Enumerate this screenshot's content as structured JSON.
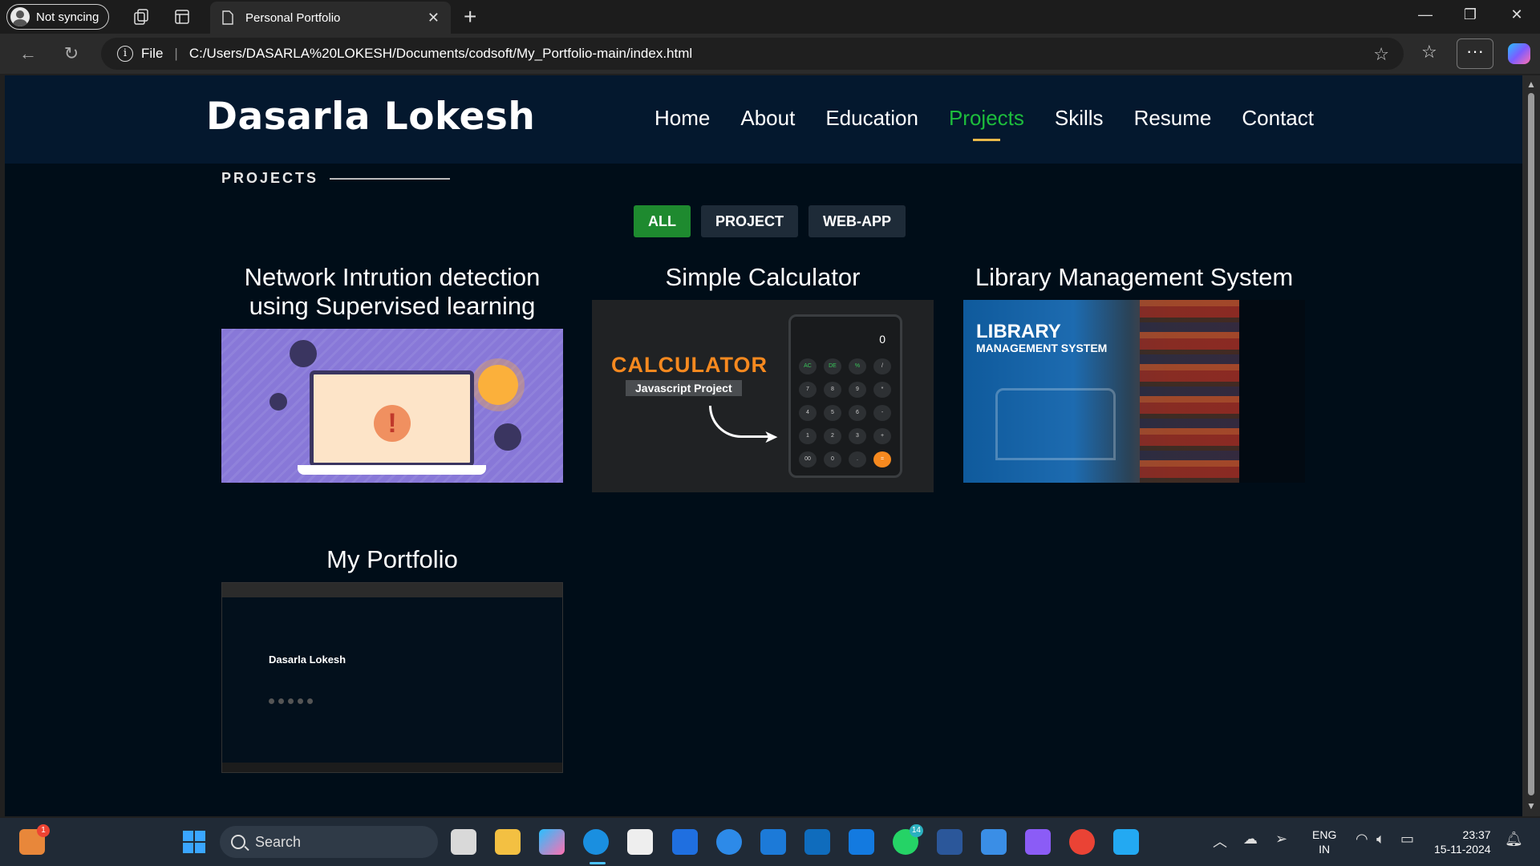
{
  "browser": {
    "profile_label": "Not syncing",
    "tab_title": "Personal Portfolio",
    "file_label": "File",
    "url": "C:/Users/DASARLA%20LOKESH/Documents/codsoft/My_Portfolio-main/index.html"
  },
  "site": {
    "brand": "Dasarla Lokesh",
    "nav": [
      "Home",
      "About",
      "Education",
      "Projects",
      "Skills",
      "Resume",
      "Contact"
    ],
    "active_nav": "Projects",
    "accent_color": "#1dbd3c",
    "underline_color": "#e8b84a"
  },
  "projects": {
    "section_title": "PROJECTS",
    "filters": [
      {
        "label": "ALL",
        "active": true
      },
      {
        "label": "PROJECT",
        "active": false
      },
      {
        "label": "WEB-APP",
        "active": false
      }
    ],
    "cards": [
      {
        "title": "Network Intrution detection using Supervised learning"
      },
      {
        "title": "Simple Calculator",
        "image_text": {
          "heading": "CALCULATOR",
          "sub": "Javascript Project",
          "display": "0"
        }
      },
      {
        "title": "Library Management System",
        "image_text": {
          "heading": "LIBRARY",
          "sub": "MANAGEMENT SYSTEM"
        }
      },
      {
        "title": "My Portfolio",
        "image_text": {
          "name": "Dasarla Lokesh"
        }
      }
    ]
  },
  "taskbar": {
    "search_placeholder": "Search",
    "whatsapp_badge": "14",
    "notif_badge": "1",
    "language": "ENG",
    "region": "IN",
    "time": "23:37",
    "date": "15-11-2024"
  }
}
